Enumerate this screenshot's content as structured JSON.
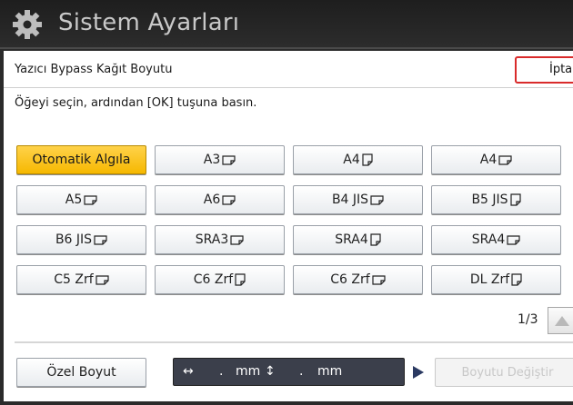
{
  "titlebar": {
    "title": "Sistem Ayarları",
    "icon": "gear-icon"
  },
  "header": {
    "label": "Yazıcı Bypass Kağıt Boyutu",
    "cancel_label": "İptal"
  },
  "instruction": "Öğeyi seçin, ardından [OK] tuşuna basın.",
  "paper_sizes": [
    {
      "label": "Otomatik Algıla",
      "orient": "",
      "selected": true
    },
    {
      "label": "A3",
      "orient": "landscape",
      "selected": false
    },
    {
      "label": "A4",
      "orient": "portrait",
      "selected": false
    },
    {
      "label": "A4",
      "orient": "landscape",
      "selected": false
    },
    {
      "label": "A5",
      "orient": "landscape",
      "selected": false
    },
    {
      "label": "A6",
      "orient": "landscape",
      "selected": false
    },
    {
      "label": "B4 JIS",
      "orient": "landscape",
      "selected": false
    },
    {
      "label": "B5 JIS",
      "orient": "portrait",
      "selected": false
    },
    {
      "label": "B6 JIS",
      "orient": "landscape",
      "selected": false
    },
    {
      "label": "SRA3",
      "orient": "landscape",
      "selected": false
    },
    {
      "label": "SRA4",
      "orient": "portrait",
      "selected": false
    },
    {
      "label": "SRA4",
      "orient": "landscape",
      "selected": false
    },
    {
      "label": "C5 Zrf",
      "orient": "landscape",
      "selected": false
    },
    {
      "label": "C6 Zrf",
      "orient": "portrait",
      "selected": false
    },
    {
      "label": "C6 Zrf",
      "orient": "landscape",
      "selected": false
    },
    {
      "label": "DL Zrf",
      "orient": "portrait",
      "selected": false
    }
  ],
  "pager": {
    "text": "1/3"
  },
  "custom": {
    "button_label": "Özel Boyut",
    "horizontal_symbol": "↔",
    "horizontal_value": ".",
    "unit": "mm",
    "vertical_symbol": "↕",
    "vertical_value": ".",
    "change_label": "Boyutu Değiştir"
  },
  "colors": {
    "selected": "#f6b800",
    "cancel_border": "#d92b2b",
    "title_bg": "#1e1e1e"
  }
}
